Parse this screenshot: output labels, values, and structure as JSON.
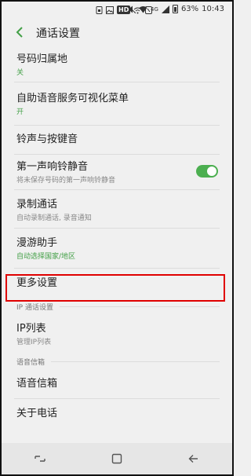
{
  "statusbar": {
    "badge_hd": "HD",
    "network": "4G",
    "battery_percent": "63%",
    "time": "10:43"
  },
  "header": {
    "title": "通话设置"
  },
  "items": {
    "home_location": {
      "title": "号码归属地",
      "sub": "关"
    },
    "self_service_menu": {
      "title": "自助语音服务可视化菜单",
      "sub": "开"
    },
    "ringtones": {
      "title": "铃声与按键音"
    },
    "first_ring_mute": {
      "title": "第一声响铃静音",
      "sub": "将未保存号码的第一声响铃静音",
      "toggle_on": true
    },
    "record_calls": {
      "title": "录制通话",
      "sub": "自动录制通话, 录音通知"
    },
    "roaming": {
      "title": "漫游助手",
      "sub": "自动选择国家/地区"
    },
    "more_settings": {
      "title": "更多设置"
    },
    "ip_section": {
      "label": "IP 通话设置"
    },
    "ip_list": {
      "title": "IP列表",
      "sub": "管理IP列表"
    },
    "voicemail_section": {
      "label": "语音信箱"
    },
    "voicemail": {
      "title": "语音信箱"
    },
    "about_phone": {
      "title": "关于电话"
    }
  },
  "colors": {
    "accent_green": "#43a047",
    "highlight_red": "#e00000"
  }
}
